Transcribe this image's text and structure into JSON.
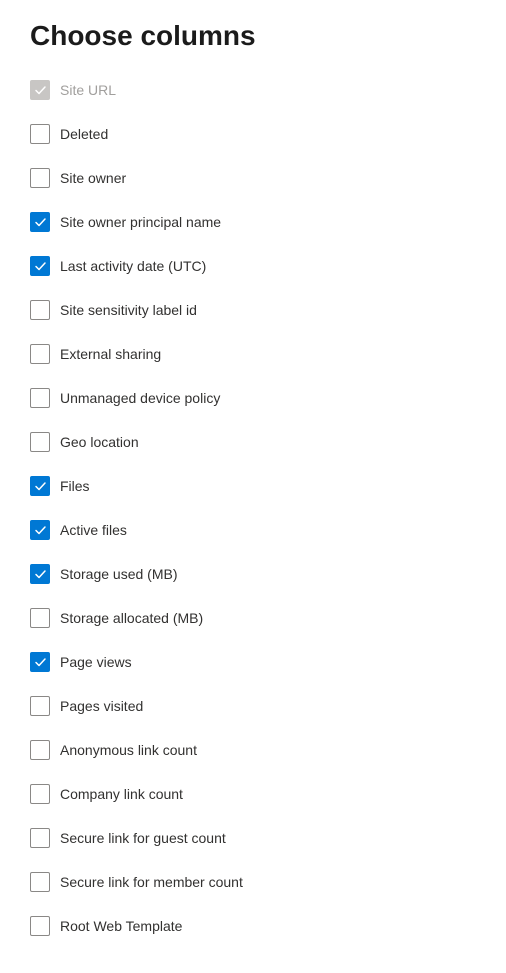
{
  "title": "Choose columns",
  "options": [
    {
      "id": "site-url",
      "label": "Site URL",
      "checked": true,
      "disabled": true
    },
    {
      "id": "deleted",
      "label": "Deleted",
      "checked": false,
      "disabled": false
    },
    {
      "id": "site-owner",
      "label": "Site owner",
      "checked": false,
      "disabled": false
    },
    {
      "id": "site-owner-principal-name",
      "label": "Site owner principal name",
      "checked": true,
      "disabled": false
    },
    {
      "id": "last-activity-date-utc",
      "label": "Last activity date (UTC)",
      "checked": true,
      "disabled": false
    },
    {
      "id": "site-sensitivity-label-id",
      "label": "Site sensitivity label id",
      "checked": false,
      "disabled": false
    },
    {
      "id": "external-sharing",
      "label": "External sharing",
      "checked": false,
      "disabled": false
    },
    {
      "id": "unmanaged-device-policy",
      "label": "Unmanaged device policy",
      "checked": false,
      "disabled": false
    },
    {
      "id": "geo-location",
      "label": "Geo location",
      "checked": false,
      "disabled": false
    },
    {
      "id": "files",
      "label": "Files",
      "checked": true,
      "disabled": false
    },
    {
      "id": "active-files",
      "label": "Active files",
      "checked": true,
      "disabled": false
    },
    {
      "id": "storage-used-mb",
      "label": "Storage used (MB)",
      "checked": true,
      "disabled": false
    },
    {
      "id": "storage-allocated-mb",
      "label": "Storage allocated (MB)",
      "checked": false,
      "disabled": false
    },
    {
      "id": "page-views",
      "label": "Page views",
      "checked": true,
      "disabled": false
    },
    {
      "id": "pages-visited",
      "label": "Pages visited",
      "checked": false,
      "disabled": false
    },
    {
      "id": "anonymous-link-count",
      "label": "Anonymous link count",
      "checked": false,
      "disabled": false
    },
    {
      "id": "company-link-count",
      "label": "Company link count",
      "checked": false,
      "disabled": false
    },
    {
      "id": "secure-link-for-guest-count",
      "label": "Secure link for guest count",
      "checked": false,
      "disabled": false
    },
    {
      "id": "secure-link-for-member-count",
      "label": "Secure link for member count",
      "checked": false,
      "disabled": false
    },
    {
      "id": "root-web-template",
      "label": "Root Web Template",
      "checked": false,
      "disabled": false
    }
  ]
}
